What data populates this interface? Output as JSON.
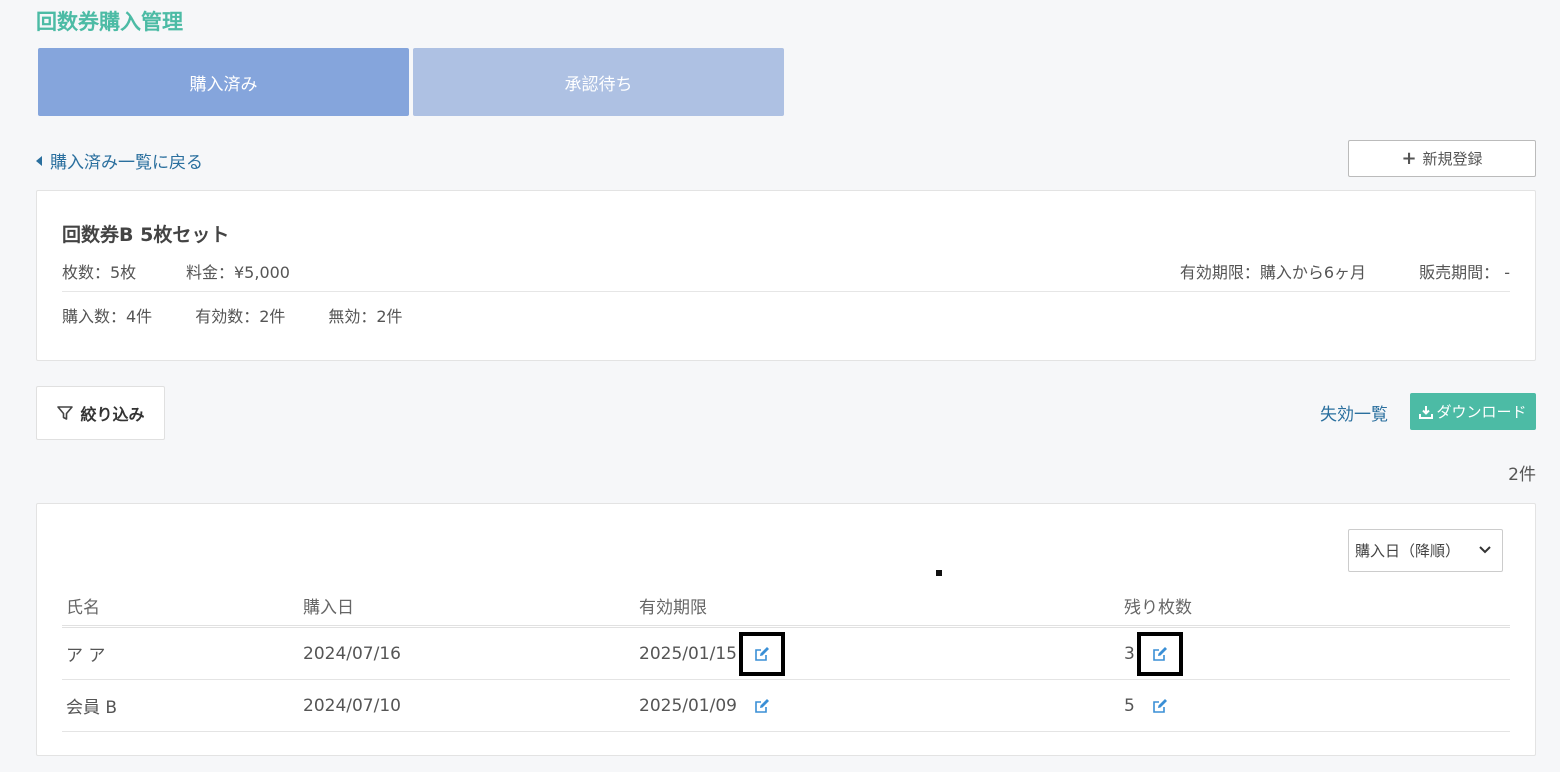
{
  "page": {
    "title": "回数券購入管理"
  },
  "tabs": [
    {
      "label": "購入済み",
      "active": true
    },
    {
      "label": "承認待ち",
      "active": false
    }
  ],
  "nav": {
    "back_label": "購入済み一覧に戻る",
    "new_label": "新規登録"
  },
  "ticket": {
    "name": "回数券B 5枚セット",
    "count": "枚数：5枚",
    "price": "料金：¥5,000",
    "validity": "有効期限：購入から6ヶ月",
    "sale_period": "販売期間： -",
    "purchases": "購入数：4件",
    "valid": "有効数：2件",
    "invalid": "無効：2件"
  },
  "toolbar": {
    "filter_label": "絞り込み",
    "expired_label": "失効一覧",
    "download_label": "ダウンロード",
    "result_count": "2件"
  },
  "sort": {
    "selected": "購入日（降順）"
  },
  "table": {
    "headers": [
      "氏名",
      "購入日",
      "有効期限",
      "残り枚数"
    ],
    "rows": [
      {
        "name": "ア ア",
        "purchase_date": "2024/07/16",
        "expiry": "2025/01/15",
        "remaining": "3"
      },
      {
        "name": "会員 B",
        "purchase_date": "2024/07/10",
        "expiry": "2025/01/09",
        "remaining": "5"
      }
    ]
  },
  "colors": {
    "accent": "#4cbba5",
    "tab_active": "#85a5dc",
    "tab_inactive": "#aec1e3",
    "link": "#2a6f9e",
    "edit_icon": "#3a8fd6"
  }
}
